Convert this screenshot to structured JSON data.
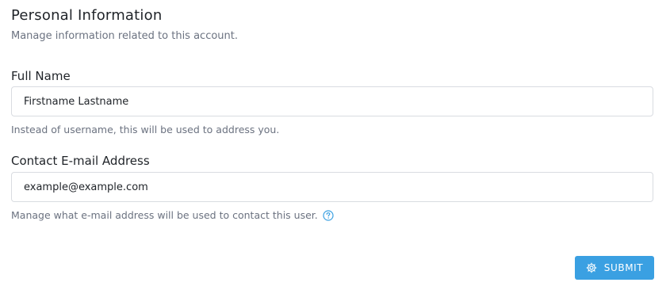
{
  "form": {
    "title": "Personal Information",
    "subtitle": "Manage information related to this account.",
    "full_name": {
      "label": "Full Name",
      "value": "Firstname Lastname",
      "helper": "Instead of username, this will be used to address you."
    },
    "email": {
      "label": "Contact E-mail Address",
      "value": "example@example.com",
      "helper": "Manage what e-mail address will be used to contact this user.",
      "help_icon": "question-circle-icon"
    },
    "submit": {
      "label": "SUBMIT",
      "icon": "gear-icon"
    }
  },
  "colors": {
    "accent": "#3aa0e2",
    "help_icon": "#3aa0e2",
    "muted_text": "#6b7280",
    "border": "#d9dce1"
  }
}
